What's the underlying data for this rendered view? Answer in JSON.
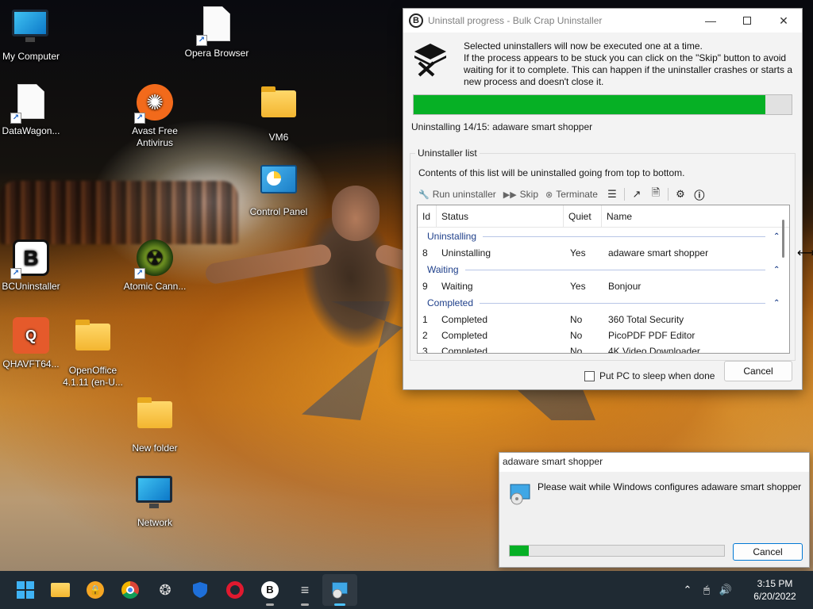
{
  "desktop": {
    "icons": [
      {
        "label": "My Computer"
      },
      {
        "label": "DataWagon..."
      },
      {
        "label": "BCUninstaller"
      },
      {
        "label": "QHAVFT64..."
      },
      {
        "label": "Opera Browser"
      },
      {
        "label": "Avast Free Antivirus"
      },
      {
        "label": "Atomic Cann..."
      },
      {
        "label": "OpenOffice 4.1.11 (en-U..."
      },
      {
        "label": "New folder"
      },
      {
        "label": "Network"
      },
      {
        "label": "VM6"
      },
      {
        "label": "Control Panel"
      }
    ]
  },
  "main_window": {
    "title": "Uninstall progress - Bulk Crap Uninstaller",
    "logo_letter": "B",
    "info_lines": [
      "Selected uninstallers will now be executed one at a time.",
      "If the process appears to be stuck you can click on the \"Skip\" button to avoid",
      "waiting for it to complete. This can happen if the uninstaller crashes or starts a",
      "new process and doesn't close it."
    ],
    "progress_fraction": 0.93,
    "status_text": "Uninstalling 14/15: adaware smart shopper",
    "group_title": "Uninstaller list",
    "group_desc": "Contents of this list will be uninstalled going from top to bottom.",
    "toolbar": {
      "run_label": "Run uninstaller",
      "skip_label": "Skip",
      "terminate_label": "Terminate"
    },
    "columns": {
      "id": "Id",
      "status": "Status",
      "quiet": "Quiet",
      "name": "Name"
    },
    "groups": [
      {
        "label": "Uninstalling",
        "rows": [
          {
            "id": "8",
            "status": "Uninstalling",
            "quiet": "Yes",
            "name": "adaware smart shopper"
          }
        ]
      },
      {
        "label": "Waiting",
        "rows": [
          {
            "id": "9",
            "status": "Waiting",
            "quiet": "Yes",
            "name": "Bonjour"
          }
        ]
      },
      {
        "label": "Completed",
        "rows": [
          {
            "id": "1",
            "status": "Completed",
            "quiet": "No",
            "name": "360 Total Security"
          },
          {
            "id": "2",
            "status": "Completed",
            "quiet": "No",
            "name": "PicoPDF PDF Editor"
          },
          {
            "id": "3",
            "status": "Completed",
            "quiet": "No",
            "name": "4K Video Downloader"
          }
        ]
      }
    ],
    "sleep_label": "Put PC to sleep when done",
    "cancel_label": "Cancel"
  },
  "dialog2": {
    "title": "adaware smart shopper",
    "message": "Please wait while Windows configures adaware smart shopper",
    "progress_fraction": 0.09,
    "cancel_label": "Cancel"
  },
  "taskbar": {
    "time": "3:15 PM",
    "date": "6/20/2022",
    "bcu_letter": "B"
  },
  "colors": {
    "progress_green": "#06b025",
    "taskbar_bg": "#1f2a33",
    "accent": "#0078d4"
  }
}
